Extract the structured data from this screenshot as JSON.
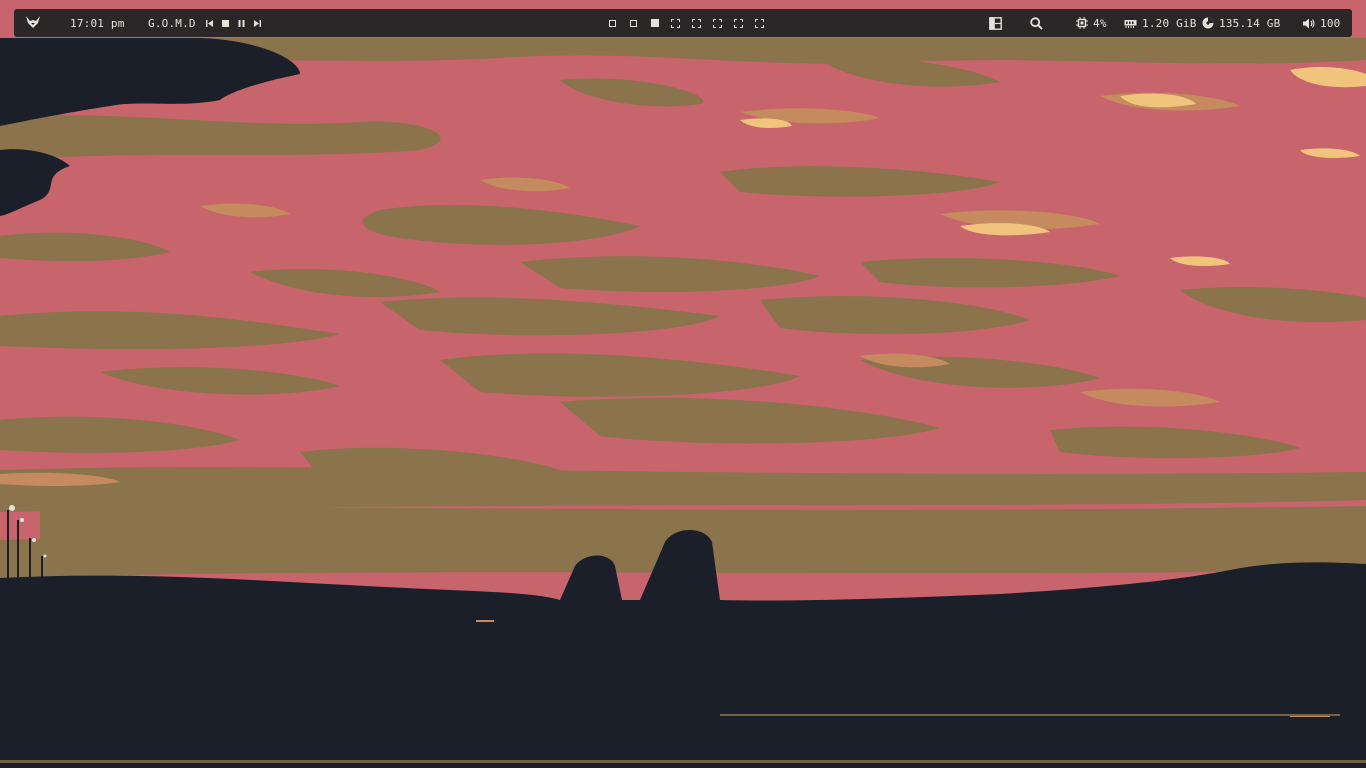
{
  "topbar": {
    "launcher_icon": "fox-icon",
    "clock": "17:01 pm",
    "media": {
      "track": "G.O.M.D",
      "controls": [
        "previous-icon",
        "stop-icon",
        "pause-icon",
        "next-icon"
      ]
    },
    "workspaces": [
      {
        "state": "occupied"
      },
      {
        "state": "occupied"
      },
      {
        "state": "active"
      },
      {
        "state": "empty"
      },
      {
        "state": "empty"
      },
      {
        "state": "empty"
      },
      {
        "state": "empty"
      },
      {
        "state": "empty"
      }
    ],
    "layout_icon": "layout-icon",
    "search_icon": "search-icon",
    "cpu": {
      "icon": "cpu-icon",
      "value": "4%"
    },
    "memory": {
      "icon": "memory-icon",
      "value": "1.20 GiB"
    },
    "disk": {
      "icon": "disk-icon",
      "value": "135.14 GB"
    },
    "volume": {
      "icon": "volume-icon",
      "value": "100"
    }
  },
  "colors": {
    "bar_bg": "#2b2627",
    "bar_fg": "#e6e2dc",
    "sky_pink": "#c8646c",
    "cloud_olive": "#8b734c",
    "cloud_tan": "#c58a5e",
    "highlight": "#f0c47c",
    "ground": "#1b1f2a"
  }
}
